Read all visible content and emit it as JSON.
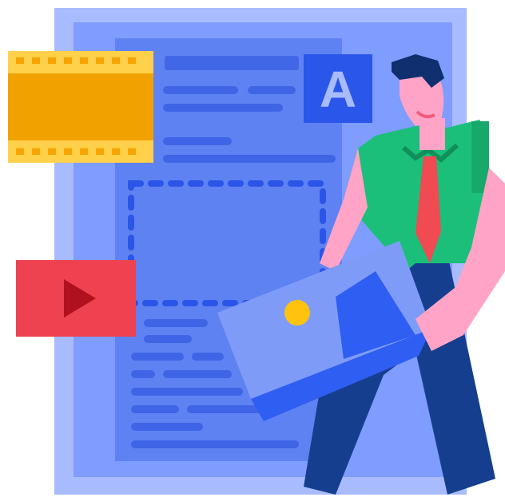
{
  "illustration": {
    "badge_letter": "A",
    "colors": {
      "document_outer": "#a8bbff",
      "document_inner": "#7f9cff",
      "page": "#5f82f2",
      "lines": "#3f65e6",
      "text_lines_dark": "#3559d8",
      "placeholder_dash": "#2a55e8",
      "badge": "#2a56ea",
      "badge_letter": "#a8bbff",
      "film_strip": "#f2a200",
      "film_border": "#ffd04a",
      "film_holes": "#f5a400",
      "video_player": "#ee4250",
      "play_icon": "#b0111f",
      "skin": "#ffa4c6",
      "hair": "#0f2f6f",
      "shirt": "#1bbf79",
      "tie": "#f04a52",
      "pants": "#153f8e",
      "photo_frame_light": "#7e9cf7",
      "photo_frame_dark": "#2f5ef3",
      "photo_sun": "#ffc20f"
    },
    "icons": [
      "film-strip-icon",
      "video-play-icon",
      "image-icon",
      "letter-a-icon"
    ]
  }
}
